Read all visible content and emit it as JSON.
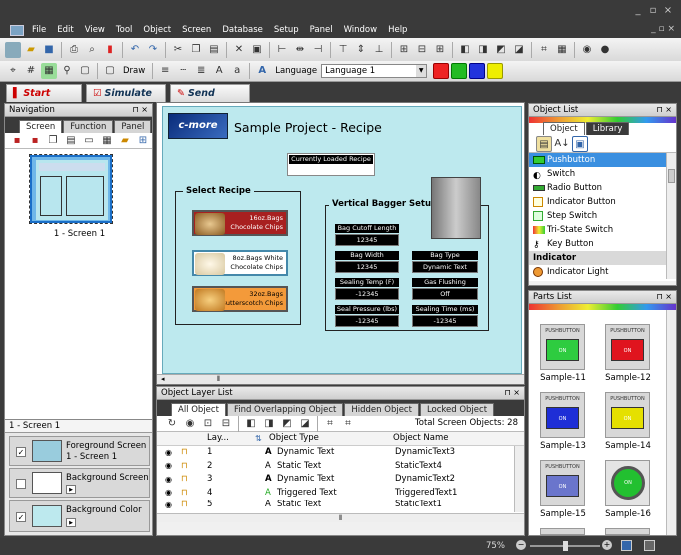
{
  "menu": [
    "File",
    "Edit",
    "View",
    "Tool",
    "Object",
    "Screen",
    "Database",
    "Setup",
    "Panel",
    "Window",
    "Help"
  ],
  "toolbar2": {
    "draw": "Draw",
    "language_label": "Language",
    "language_value": "Language 1"
  },
  "modes": {
    "start": "Start",
    "simulate": "Simulate",
    "send": "Send"
  },
  "navigation": {
    "title": "Navigation",
    "tabs": [
      "Screen",
      "Function",
      "Panel"
    ],
    "thumb_label": "1 - Screen 1"
  },
  "layers": {
    "screen_label": "1 - Screen 1",
    "items": [
      {
        "label": "Foreground Screen",
        "sub": "1 - Screen 1",
        "checked": "✓"
      },
      {
        "label": "Background Screen",
        "sub": "",
        "checked": ""
      },
      {
        "label": "Background Color",
        "sub": "",
        "checked": "✓"
      }
    ]
  },
  "canvas": {
    "logo": "c-more",
    "title": "Sample Project - Recipe",
    "loaded_label": "Currently Loaded Recipe",
    "select_recipe": "Select Recipe",
    "bagger_setup": "Vertical Bagger Setup",
    "recipes": [
      {
        "line1": "16oz.Bags",
        "line2": "Chocolate Chips"
      },
      {
        "line1": "8oz.Bags White",
        "line2": "Chocolate Chips"
      },
      {
        "line1": "32oz.Bags",
        "line2": "Butterscotch Chips"
      }
    ],
    "fields": [
      {
        "label": "Bag Cutoff Length",
        "value": "12345"
      },
      {
        "label": "Bag Width",
        "value": "12345"
      },
      {
        "label": "Bag Type",
        "value": "Dynamic Text"
      },
      {
        "label": "Sealing Temp (F)",
        "value": "-12345"
      },
      {
        "label": "Gas Flushing",
        "value": "Off"
      },
      {
        "label": "Seal Pressure (lbs)",
        "value": "-12345"
      },
      {
        "label": "Sealing Time (ms)",
        "value": "-12345"
      }
    ]
  },
  "object_layer": {
    "title": "Object Layer List",
    "tabs": [
      "All Object",
      "Find Overlapping Object",
      "Hidden Object",
      "Locked Object"
    ],
    "total": "Total Screen Objects: 28",
    "headers": [
      "Lay...",
      "Object Type",
      "Object Name"
    ],
    "rows": [
      {
        "n": "1",
        "type": "Dynamic Text",
        "name": "DynamicText3",
        "icon": "A"
      },
      {
        "n": "2",
        "type": "Static Text",
        "name": "StaticText4",
        "icon": "A"
      },
      {
        "n": "3",
        "type": "Dynamic Text",
        "name": "DynamicText2",
        "icon": "A"
      },
      {
        "n": "4",
        "type": "Triggered Text",
        "name": "TriggeredText1",
        "icon": "A"
      },
      {
        "n": "5",
        "type": "Static Text",
        "name": "StaticText1",
        "icon": "A"
      }
    ]
  },
  "object_list": {
    "title": "Object List",
    "tabs": [
      "Object",
      "Library"
    ],
    "items": [
      "Pushbutton",
      "Switch",
      "Radio Button",
      "Indicator Button",
      "Step Switch",
      "Tri-State Switch",
      "Key Button"
    ],
    "section": "Indicator",
    "last": "Indicator Light"
  },
  "parts_list": {
    "title": "Parts List",
    "items": [
      {
        "name": "Sample-11",
        "header": "PUSHBUTTON",
        "btn": "ON",
        "color": "#2ecc40"
      },
      {
        "name": "Sample-12",
        "header": "PUSHBUTTON",
        "btn": "ON",
        "color": "#e0141e"
      },
      {
        "name": "Sample-13",
        "header": "PUSHBUTTON",
        "btn": "ON",
        "color": "#1e2ed6"
      },
      {
        "name": "Sample-14",
        "header": "PUSHBUTTON",
        "btn": "ON",
        "color": "#e5e000"
      },
      {
        "name": "Sample-15",
        "header": "PUSHBUTTON",
        "btn": "ON",
        "color": "#6a75cc"
      },
      {
        "name": "Sample-16",
        "header": "",
        "btn": "ON",
        "color": "#22c030"
      }
    ]
  },
  "status": {
    "zoom": "75%"
  }
}
